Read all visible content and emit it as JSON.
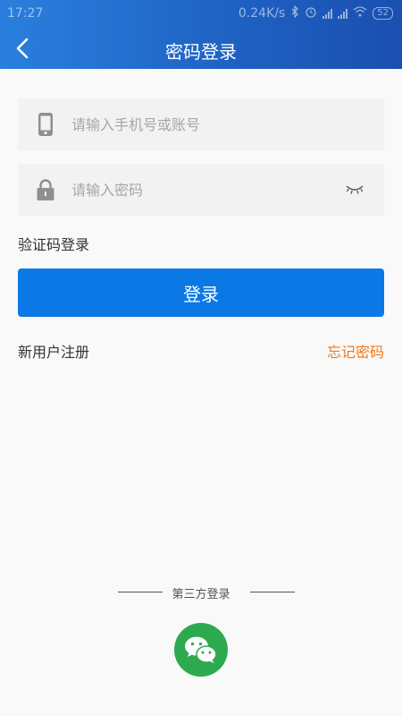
{
  "status_bar": {
    "time": "17:27",
    "network_speed": "0.24K/s",
    "battery": "52"
  },
  "header": {
    "title": "密码登录"
  },
  "form": {
    "account_placeholder": "请输入手机号或账号",
    "password_placeholder": "请输入密码"
  },
  "links": {
    "sms_login": "验证码登录",
    "register": "新用户注册",
    "forgot_password": "忘记密码"
  },
  "login_button": {
    "label": "登录"
  },
  "third_party": {
    "label": "第三方登录"
  },
  "colors": {
    "accent": "#0a79e5",
    "header_blue": "#1f63c4",
    "forgot_orange": "#f07a1e",
    "wechat_green": "#2daa4f"
  },
  "icons": {
    "back": "chevron-left-icon",
    "phone": "phone-icon",
    "lock": "lock-icon",
    "eye": "eye-closed-icon",
    "wechat": "wechat-icon"
  }
}
